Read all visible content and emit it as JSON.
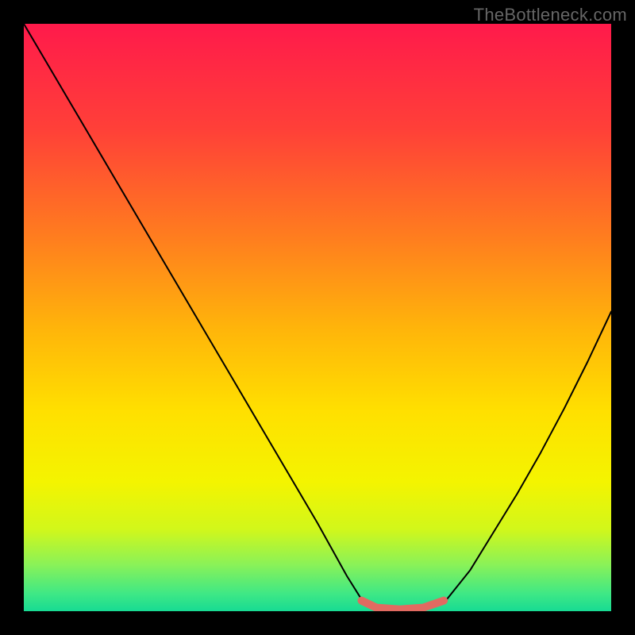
{
  "watermark": "TheBottleneck.com",
  "chart_data": {
    "type": "line",
    "title": "",
    "xlabel": "",
    "ylabel": "",
    "xlim": [
      0,
      1
    ],
    "ylim": [
      0,
      1
    ],
    "grid": false,
    "legend": null,
    "background_gradient_stops": [
      {
        "offset": 0.0,
        "color": "#ff1a4b"
      },
      {
        "offset": 0.18,
        "color": "#ff4038"
      },
      {
        "offset": 0.36,
        "color": "#ff7c1f"
      },
      {
        "offset": 0.52,
        "color": "#ffb50a"
      },
      {
        "offset": 0.66,
        "color": "#ffe000"
      },
      {
        "offset": 0.78,
        "color": "#f4f400"
      },
      {
        "offset": 0.86,
        "color": "#d2f71a"
      },
      {
        "offset": 0.92,
        "color": "#8bf257"
      },
      {
        "offset": 0.97,
        "color": "#3fe885"
      },
      {
        "offset": 1.0,
        "color": "#17db93"
      }
    ],
    "series": [
      {
        "name": "bottleneck-curve",
        "color": "#000000",
        "stroke_width": 2,
        "x": [
          0.0,
          0.05,
          0.1,
          0.15,
          0.2,
          0.25,
          0.3,
          0.35,
          0.4,
          0.45,
          0.5,
          0.55,
          0.575,
          0.6,
          0.64,
          0.68,
          0.72,
          0.76,
          0.8,
          0.84,
          0.88,
          0.92,
          0.96,
          1.0
        ],
        "values": [
          1.0,
          0.915,
          0.83,
          0.745,
          0.66,
          0.575,
          0.49,
          0.405,
          0.32,
          0.235,
          0.15,
          0.06,
          0.02,
          0.0,
          0.0,
          0.0,
          0.02,
          0.07,
          0.135,
          0.2,
          0.27,
          0.345,
          0.425,
          0.51
        ]
      },
      {
        "name": "minimum-marker",
        "color": "#e26a61",
        "stroke_width": 10,
        "x": [
          0.575,
          0.6,
          0.64,
          0.68,
          0.715
        ],
        "values": [
          0.018,
          0.006,
          0.003,
          0.006,
          0.018
        ]
      }
    ]
  }
}
